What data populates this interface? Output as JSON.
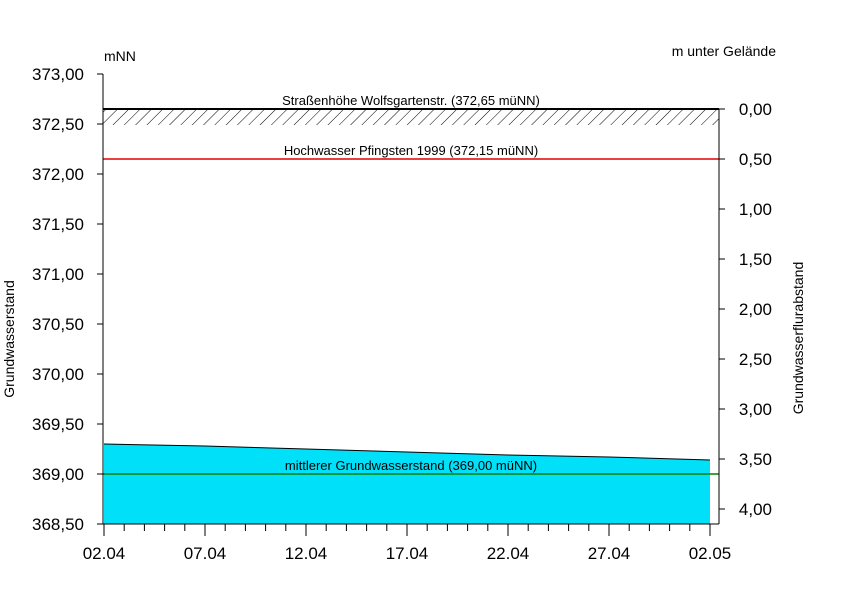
{
  "chart_data": {
    "type": "area",
    "left_unit": "mNN",
    "right_unit": "m unter Gelände",
    "ylabel": "Grundwasserstand",
    "ylabel_right": "Grundwasserflurabstand",
    "ylim": [
      368.5,
      373.0
    ],
    "ylim_right": [
      4.0,
      0.0
    ],
    "ground_level": 372.65,
    "y_ticks": [
      {
        "value": 373.0,
        "label": "373,00"
      },
      {
        "value": 372.5,
        "label": "372,50"
      },
      {
        "value": 372.0,
        "label": "372,00"
      },
      {
        "value": 371.5,
        "label": "371,50"
      },
      {
        "value": 371.0,
        "label": "371,00"
      },
      {
        "value": 370.5,
        "label": "370,50"
      },
      {
        "value": 370.0,
        "label": "370,00"
      },
      {
        "value": 369.5,
        "label": "369,50"
      },
      {
        "value": 369.0,
        "label": "369,00"
      },
      {
        "value": 368.5,
        "label": "368,50"
      }
    ],
    "y_ticks_right": [
      {
        "value": 0.0,
        "label": "0,00"
      },
      {
        "value": 0.5,
        "label": "0,50"
      },
      {
        "value": 1.0,
        "label": "1,00"
      },
      {
        "value": 1.5,
        "label": "1,50"
      },
      {
        "value": 2.0,
        "label": "2,00"
      },
      {
        "value": 2.5,
        "label": "2,50"
      },
      {
        "value": 3.0,
        "label": "3,00"
      },
      {
        "value": 3.5,
        "label": "3,50"
      },
      {
        "value": 4.0,
        "label": "4,00"
      }
    ],
    "x_range": [
      "2024-04-02",
      "2024-05-02"
    ],
    "x_ticks": [
      {
        "date": "2024-04-02",
        "label": "02.04"
      },
      {
        "date": "2024-04-07",
        "label": "07.04"
      },
      {
        "date": "2024-04-12",
        "label": "12.04"
      },
      {
        "date": "2024-04-17",
        "label": "17.04"
      },
      {
        "date": "2024-04-22",
        "label": "22.04"
      },
      {
        "date": "2024-04-27",
        "label": "27.04"
      },
      {
        "date": "2024-05-02",
        "label": "02.05"
      }
    ],
    "series": [
      {
        "color": "#00e0f8",
        "points": [
          {
            "x": "2024-04-02",
            "y": 369.3
          },
          {
            "x": "2024-04-07",
            "y": 369.28
          },
          {
            "x": "2024-04-12",
            "y": 369.25
          },
          {
            "x": "2024-04-17",
            "y": 369.22
          },
          {
            "x": "2024-04-22",
            "y": 369.19
          },
          {
            "x": "2024-04-27",
            "y": 369.17
          },
          {
            "x": "2024-05-02",
            "y": 369.14
          }
        ]
      }
    ],
    "reference_lines": [
      {
        "value": 372.65,
        "label": "Straßenhöhe Wolfsgartenstr. (372,65 müNN)",
        "color": "#000000",
        "hatched": true
      },
      {
        "value": 372.15,
        "label": "Hochwasser Pfingsten 1999 (372,15 müNN)",
        "color": "#e00000",
        "hatched": false
      },
      {
        "value": 369.0,
        "label": "mittlerer Grundwasserstand (369,00 müNN)",
        "color": "#008000",
        "hatched": false
      }
    ],
    "grid": false
  }
}
